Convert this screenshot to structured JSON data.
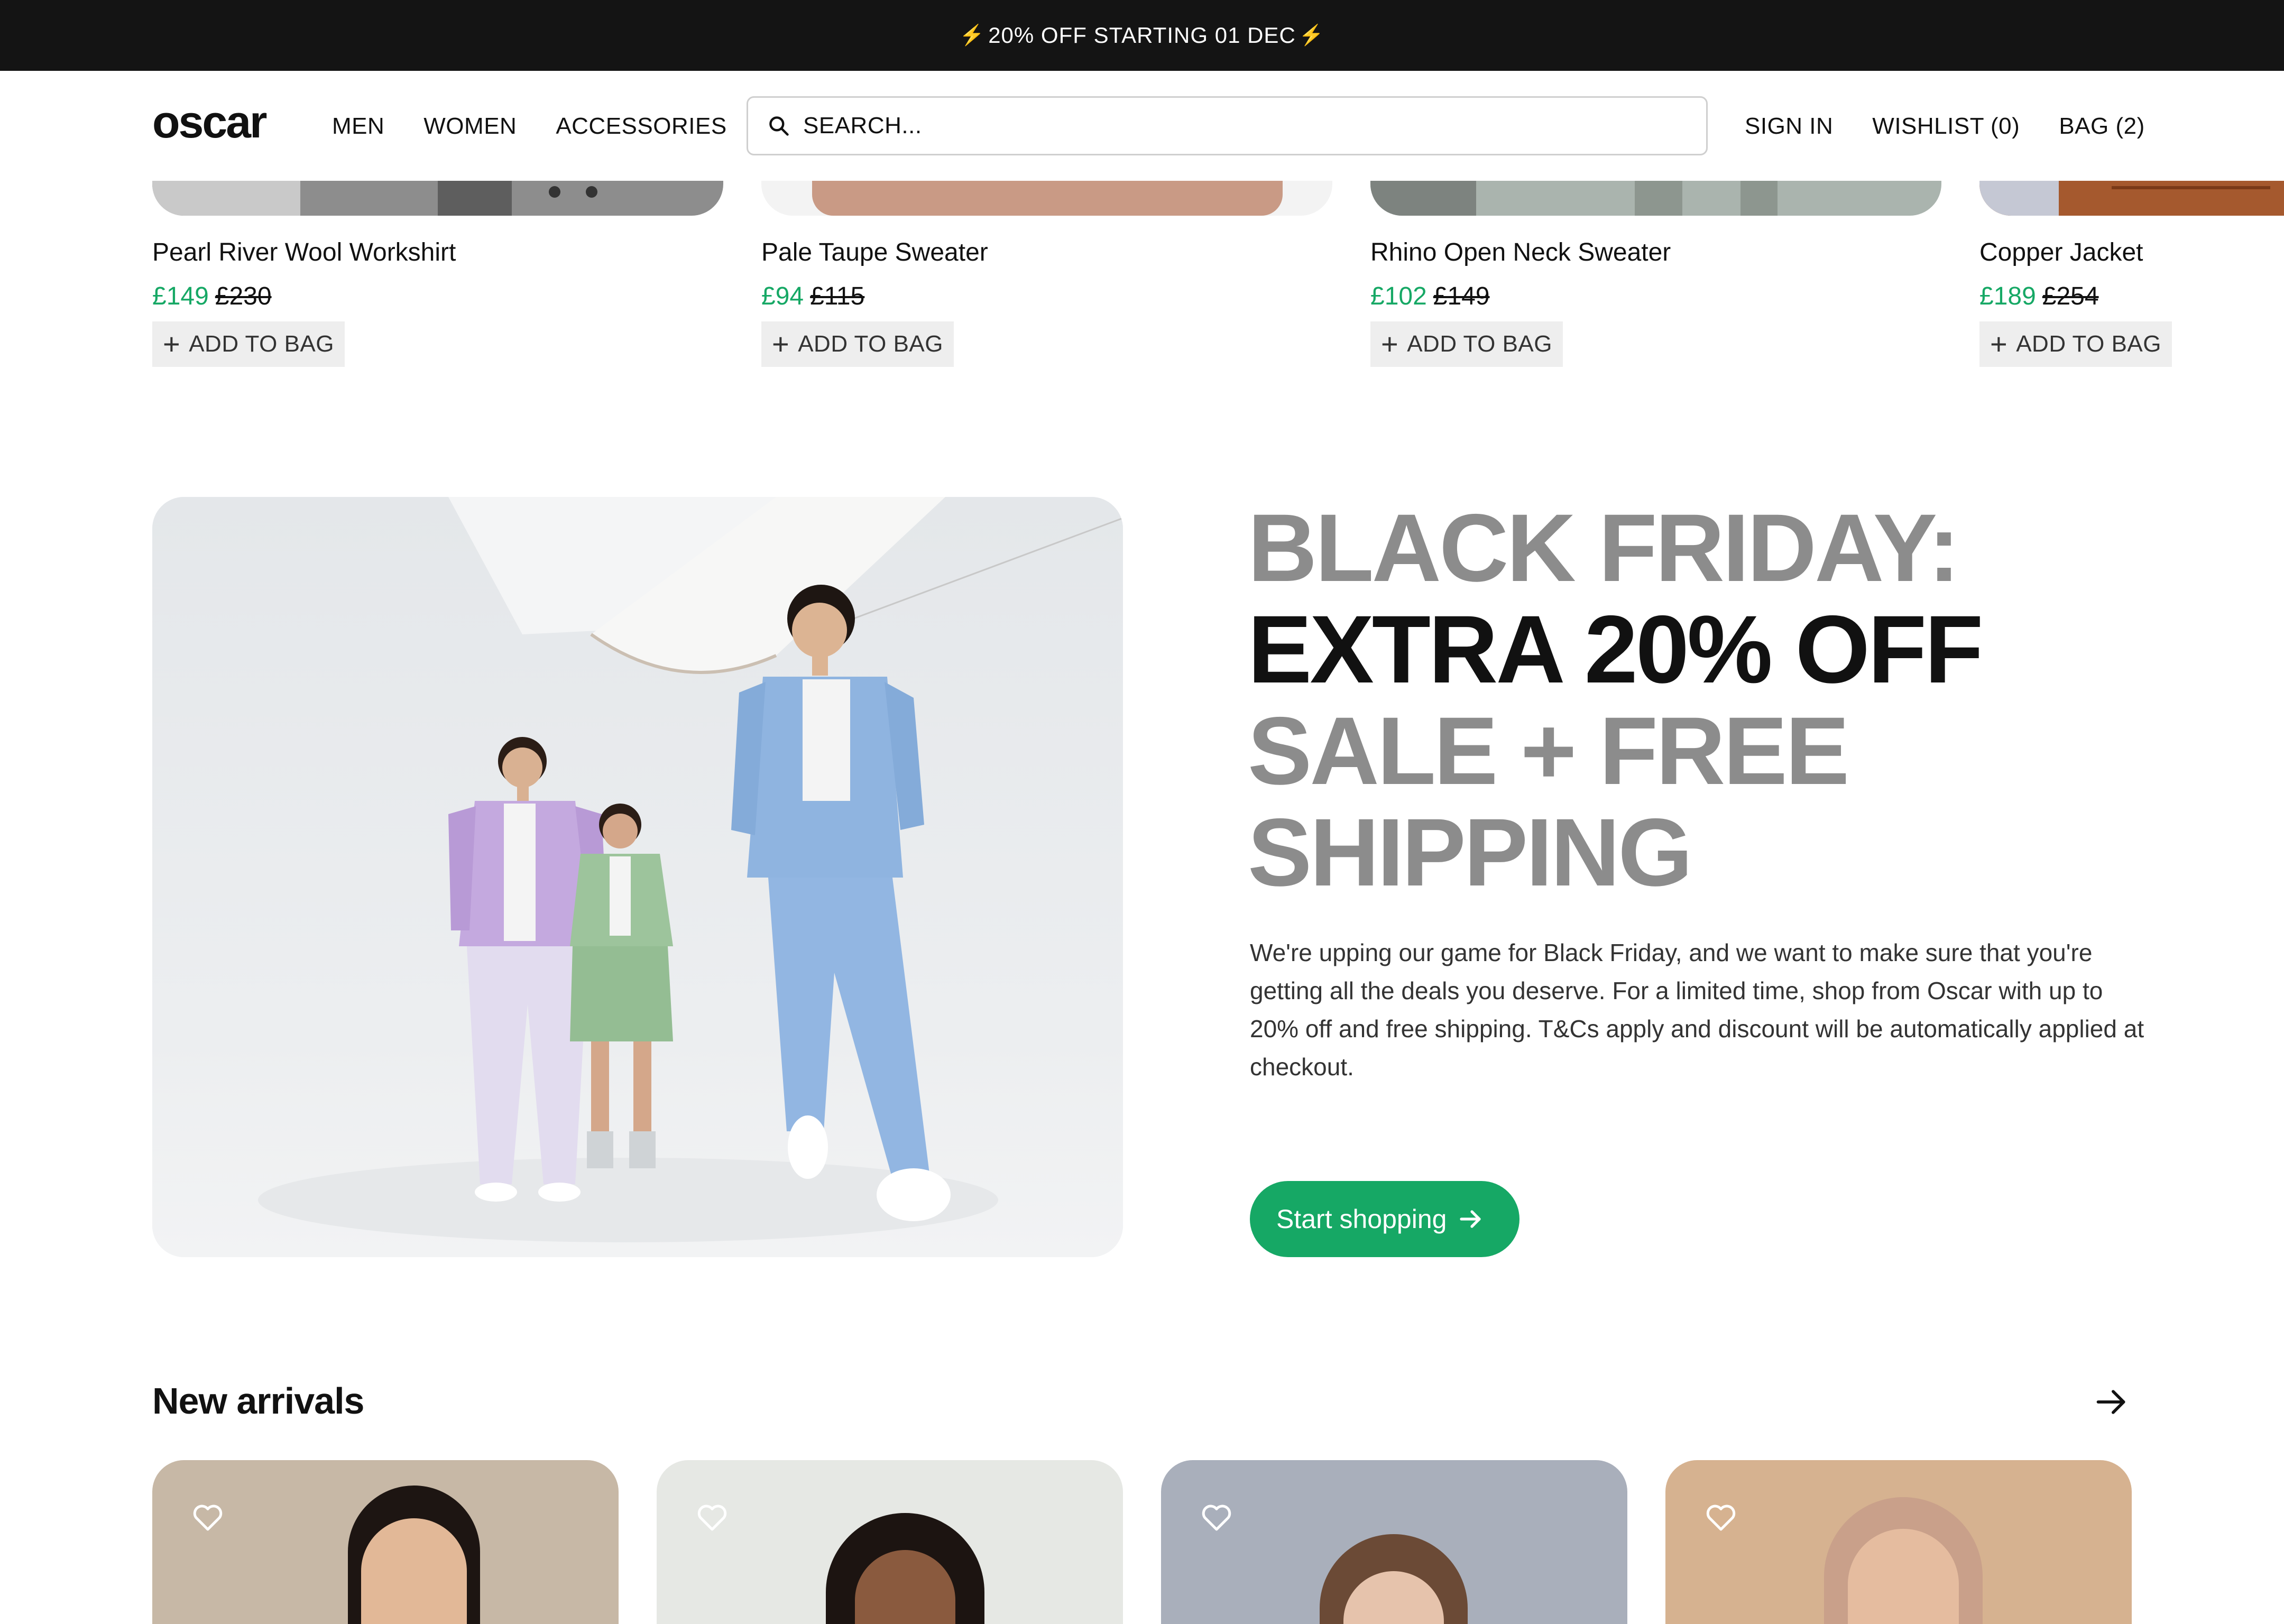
{
  "promo_bar": {
    "text": "20% OFF STARTING 01 DEC"
  },
  "header": {
    "logo": "oscar",
    "nav": [
      {
        "label": "MEN"
      },
      {
        "label": "WOMEN"
      },
      {
        "label": "ACCESSORIES"
      }
    ],
    "search": {
      "placeholder": "SEARCH..."
    },
    "account_nav": [
      {
        "label": "SIGN IN"
      },
      {
        "label": "WISHLIST (0)"
      },
      {
        "label": "BAG (2)"
      }
    ]
  },
  "top_products": [
    {
      "name": "Pearl River Wool Workshirt",
      "price": "£149",
      "old_price": "£230",
      "add_label": "ADD TO BAG"
    },
    {
      "name": "Pale Taupe Sweater",
      "price": "£94",
      "old_price": "£115",
      "add_label": "ADD TO BAG"
    },
    {
      "name": "Rhino Open Neck Sweater",
      "price": "£102",
      "old_price": "£149",
      "add_label": "ADD TO BAG"
    },
    {
      "name": "Copper Jacket",
      "price": "£189",
      "old_price": "£254",
      "add_label": "ADD TO BAG"
    }
  ],
  "hero": {
    "title_line1": "BLACK FRIDAY:",
    "title_line2": "EXTRA 20% OFF",
    "title_line3": "SALE + FREE",
    "title_line4": "SHIPPING",
    "body": "We're upping our game for Black Friday, and we want to make sure that you're getting all the deals you deserve. For a limited time, shop from Oscar with up to 20% off and free shipping. T&Cs apply and discount will be automatically applied at checkout.",
    "cta_label": "Start shopping"
  },
  "new_arrivals": {
    "title": "New arrivals"
  },
  "colors": {
    "accent_green": "#16a865",
    "promo_bg": "#141414",
    "hero_grey_text": "#8c8c8c"
  }
}
